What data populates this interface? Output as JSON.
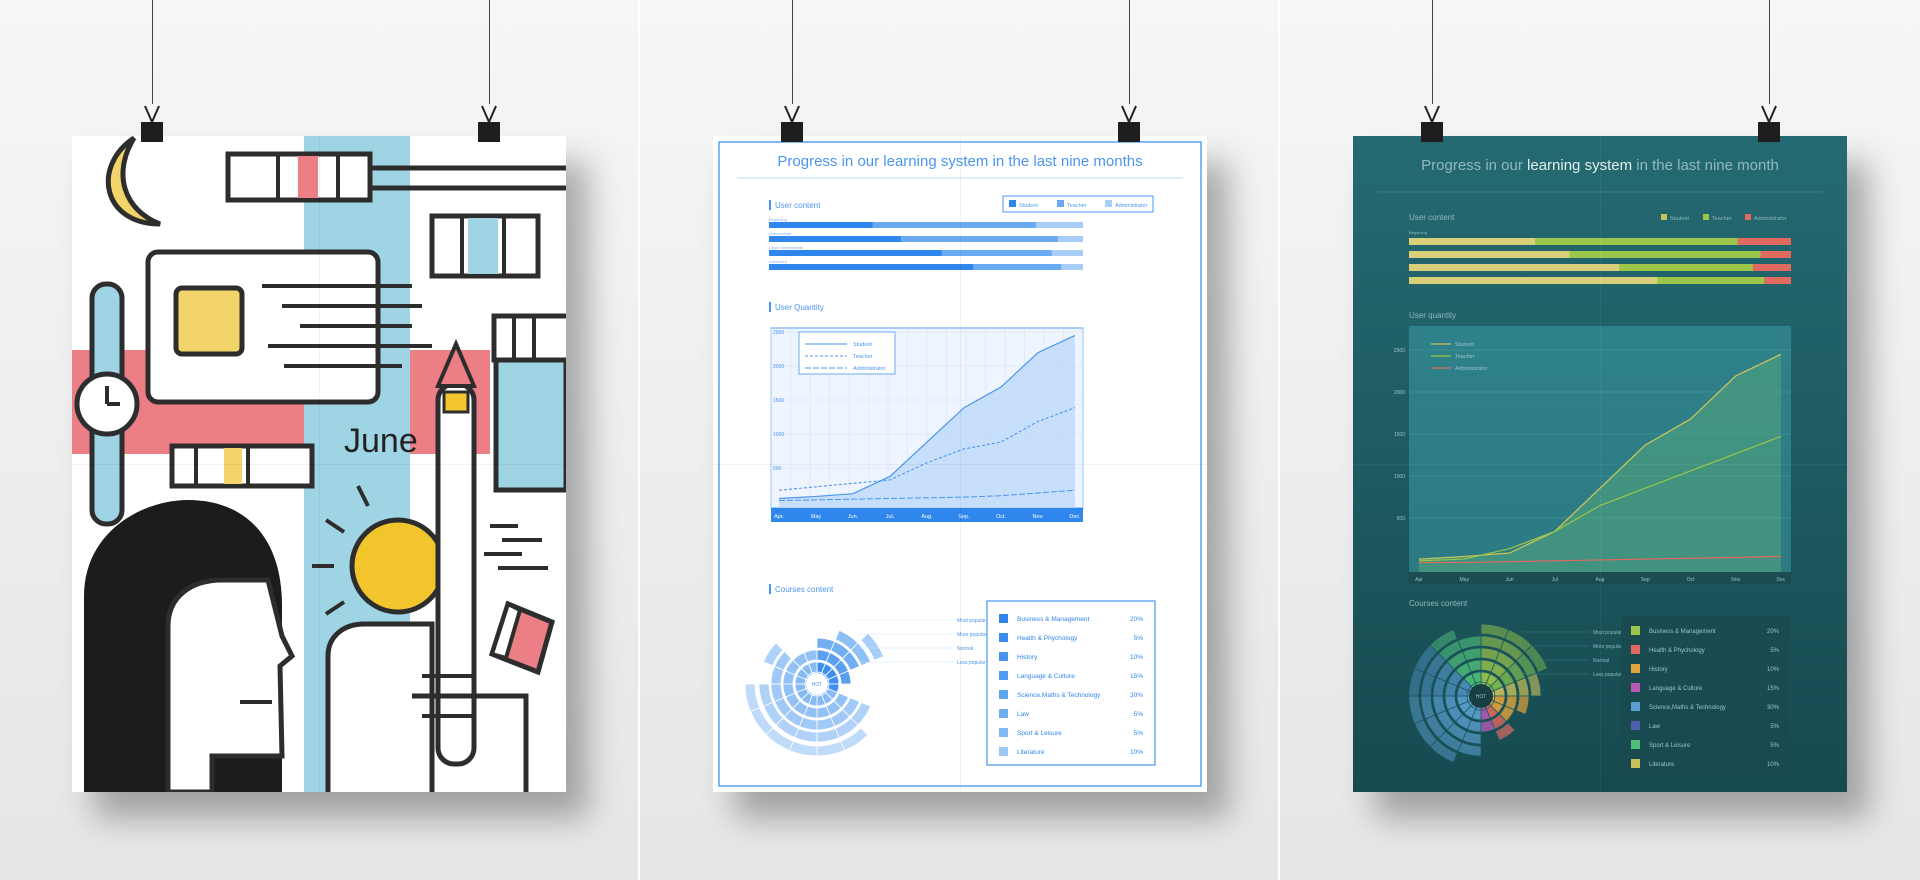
{
  "poster_1": {
    "month": "June"
  },
  "poster_2": {
    "title": "Progress in our learning system in the last nine months",
    "legend": [
      "Student",
      "Teacher",
      "Administrator"
    ],
    "sections": {
      "user_content": "User content",
      "user_quantity": "User Quantity",
      "courses_content": "Courses content"
    },
    "bar_labels": [
      "Beginning",
      "Intermediate",
      "Upper intermediate",
      "Advanced"
    ],
    "y_ticks": [
      "2500",
      "2000",
      "1500",
      "1000",
      "500"
    ],
    "months": [
      "Apr.",
      "May",
      "Jun.",
      "Jul.",
      "Aug.",
      "Sep.",
      "Oct.",
      "Nov.",
      "Dec."
    ],
    "polar_center": "HOT",
    "polar_labels": [
      "Most popular",
      "More popular",
      "Normal",
      "Less popular"
    ],
    "courses": [
      {
        "name": "Business & Management",
        "pct": "20%"
      },
      {
        "name": "Health & Phychology",
        "pct": "5%"
      },
      {
        "name": "History",
        "pct": "10%"
      },
      {
        "name": "Language & Culture",
        "pct": "15%"
      },
      {
        "name": "Science,Maths & Technology",
        "pct": "30%"
      },
      {
        "name": "Law",
        "pct": "5%"
      },
      {
        "name": "Sport & Leisure",
        "pct": "5%"
      },
      {
        "name": "Literature",
        "pct": "10%"
      }
    ]
  },
  "poster_3": {
    "title_parts": [
      "Progress in our ",
      "learning system",
      " in the last nine month"
    ],
    "legend": [
      "Student",
      "Teacher",
      "Administrator"
    ],
    "sections": {
      "user_content": "User content",
      "user_quantity": "User quantity",
      "courses_content": "Courses content"
    },
    "bar_labels": [
      "Beginning"
    ],
    "y_ticks": [
      "2500",
      "2000",
      "1500",
      "1000",
      "500"
    ],
    "months": [
      "Apr",
      "May",
      "Jun",
      "Jul",
      "Aug",
      "Sep",
      "Oct",
      "Nov",
      "Dec"
    ],
    "polar_center": "HOT",
    "polar_labels": [
      "Most popular",
      "More popular",
      "Normal",
      "Less popular"
    ],
    "courses": [
      {
        "name": "Business & Management",
        "pct": "20%"
      },
      {
        "name": "Health & Phychology",
        "pct": "5%"
      },
      {
        "name": "History",
        "pct": "10%"
      },
      {
        "name": "Language & Culture",
        "pct": "15%"
      },
      {
        "name": "Science,Maths & Technology",
        "pct": "30%"
      },
      {
        "name": "Law",
        "pct": "5%"
      },
      {
        "name": "Sport & Leisure",
        "pct": "5%"
      },
      {
        "name": "Literature",
        "pct": "10%"
      }
    ],
    "course_colors": [
      "#9bc64a",
      "#e06a60",
      "#e3a33c",
      "#b65ab8",
      "#5a9fd0",
      "#4e5fae",
      "#4fc07a",
      "#c9c25a"
    ]
  }
}
